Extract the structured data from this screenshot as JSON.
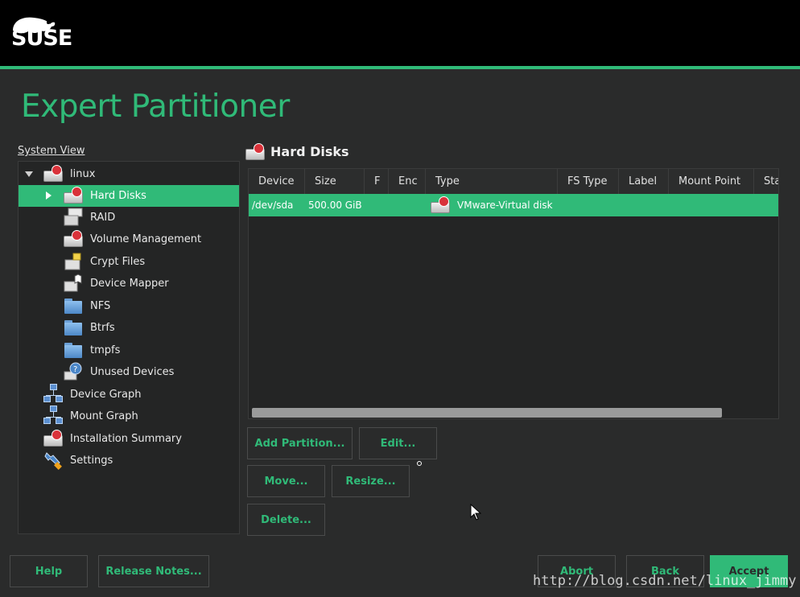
{
  "brand": {
    "logo_text": "SUSE"
  },
  "page": {
    "title": "Expert Partitioner"
  },
  "system_view": {
    "label": "System View",
    "items": [
      {
        "label": "linux",
        "icon": "disk-icon",
        "level": 0,
        "expanded": true
      },
      {
        "label": "Hard Disks",
        "icon": "disk-icon",
        "level": 1,
        "selected": true,
        "collapsed": true
      },
      {
        "label": "RAID",
        "icon": "raid-icon",
        "level": 1
      },
      {
        "label": "Volume Management",
        "icon": "disk-icon",
        "level": 1
      },
      {
        "label": "Crypt Files",
        "icon": "crypt-file-icon",
        "level": 1
      },
      {
        "label": "Device Mapper",
        "icon": "device-mapper-icon",
        "level": 1
      },
      {
        "label": "NFS",
        "icon": "folder-icon",
        "level": 1
      },
      {
        "label": "Btrfs",
        "icon": "folder-icon",
        "level": 1
      },
      {
        "label": "tmpfs",
        "icon": "folder-icon",
        "level": 1
      },
      {
        "label": "Unused Devices",
        "icon": "unused-devices-icon",
        "level": 1
      },
      {
        "label": "Device Graph",
        "icon": "graph-icon",
        "level": 0
      },
      {
        "label": "Mount Graph",
        "icon": "graph-icon",
        "level": 0
      },
      {
        "label": "Installation Summary",
        "icon": "disk-icon",
        "level": 0
      },
      {
        "label": "Settings",
        "icon": "wrench-icon",
        "level": 0
      }
    ]
  },
  "section": {
    "title": "Hard Disks",
    "icon": "disk-icon"
  },
  "table": {
    "columns": [
      "Device",
      "Size",
      "F",
      "Enc",
      "Type",
      "FS Type",
      "Label",
      "Mount Point",
      "Sta"
    ],
    "rows": [
      {
        "device": "/dev/sda",
        "size": "500.00 GiB",
        "f": "",
        "enc": "",
        "type": "VMware-Virtual disk",
        "fs_type": "",
        "label": "",
        "mount_point": "",
        "start": ""
      }
    ]
  },
  "actions": {
    "add_partition": "Add Partition...",
    "edit": "Edit...",
    "move": "Move...",
    "resize": "Resize...",
    "delete": "Delete..."
  },
  "footer": {
    "help": "Help",
    "release_notes": "Release Notes...",
    "abort": "Abort",
    "back": "Back",
    "accept": "Accept"
  },
  "watermark": "http://blog.csdn.net/linux_jimmy",
  "colors": {
    "accent": "#30ba78",
    "background": "#2a2b2b",
    "header": "#000000"
  }
}
